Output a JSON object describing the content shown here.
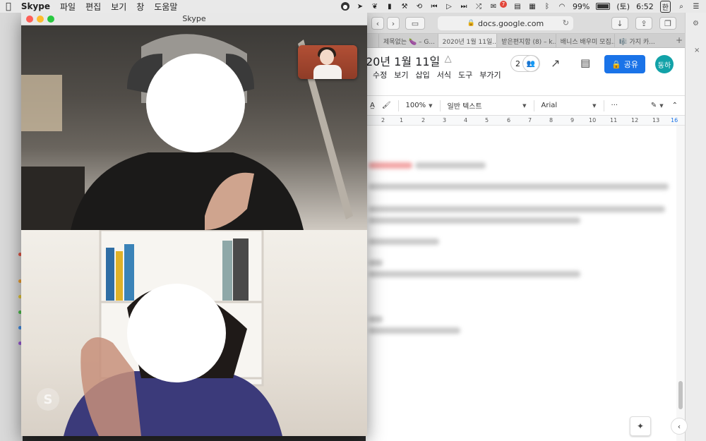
{
  "menubar": {
    "apple": "",
    "app": "Skype",
    "menus": [
      "파일",
      "편집",
      "보기",
      "창",
      "도움말"
    ],
    "battery": "99%",
    "day": "(토)",
    "time": "6:52",
    "input_method": "한",
    "mail_badge": "7"
  },
  "safari": {
    "url": "docs.google.com",
    "tabs": [
      "제목없는 🍆 – G...",
      "2020년 1월 11일...",
      "받은편지함 (8) – k...",
      "배니스 배우미 모집...",
      "🎼 가지 카..."
    ]
  },
  "docs": {
    "title": "20년 1월 11일",
    "menus": [
      "수정",
      "보기",
      "삽입",
      "서식",
      "도구",
      "부가기"
    ],
    "collab_count": "2",
    "share_label": "공유",
    "user_initials": "동하",
    "zoom": "100%",
    "style": "일반 텍스트",
    "font": "Arial",
    "more": "···",
    "ruler": [
      "2",
      "1",
      "2",
      "3",
      "4",
      "5",
      "6",
      "7",
      "8",
      "9",
      "10",
      "11",
      "12",
      "13",
      "14",
      "15",
      "16"
    ]
  },
  "skype": {
    "title": "Skype"
  },
  "colors": {
    "share_blue": "#1a73e8",
    "avatar_teal": "#12a2a8",
    "close_red": "#fe5f57",
    "minimize_yellow": "#febc2e",
    "zoom_green": "#28c840"
  }
}
